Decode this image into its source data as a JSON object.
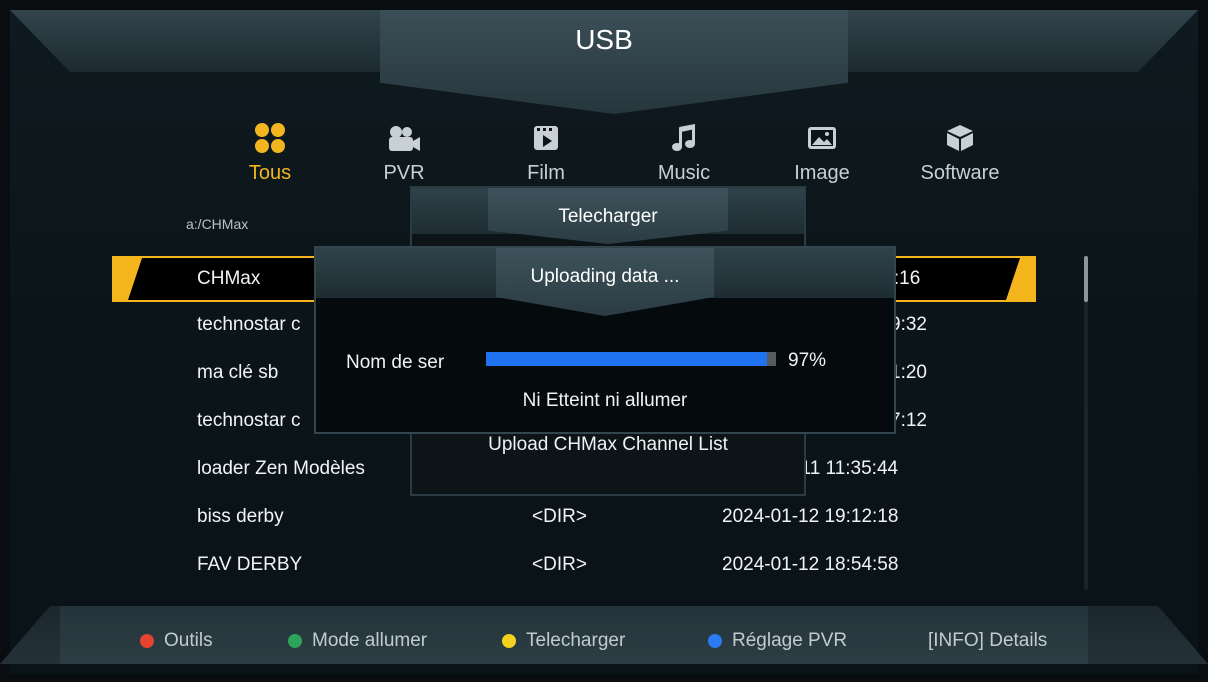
{
  "header": {
    "title": "USB"
  },
  "categories": [
    {
      "label": "Tous",
      "icon": "grid-icon",
      "active": true
    },
    {
      "label": "PVR",
      "icon": "camera-icon",
      "active": false
    },
    {
      "label": "Film",
      "icon": "film-icon",
      "active": false
    },
    {
      "label": "Music",
      "icon": "music-note-icon",
      "active": false
    },
    {
      "label": "Image",
      "icon": "image-icon",
      "active": false
    },
    {
      "label": "Software",
      "icon": "box-icon",
      "active": false
    }
  ],
  "path": "a:/CHMax",
  "files": [
    {
      "name": "CHMax",
      "type": "",
      "date": ":2:16"
    },
    {
      "name": "technostar c",
      "type": "",
      "date": "9:32"
    },
    {
      "name": "ma clé sb",
      "type": "",
      "date": "1:20"
    },
    {
      "name": "technostar c",
      "type": "",
      "date": "7:12"
    },
    {
      "name": "loader Zen Modèles",
      "type": "",
      "date": "l-11 11:35:44"
    },
    {
      "name": "biss derby",
      "type": "<DIR>",
      "date": "2024-01-12 19:12:18"
    },
    {
      "name": "FAV DERBY",
      "type": "<DIR>",
      "date": "2024-01-12 18:54:58"
    }
  ],
  "dialog_download": {
    "title": "Telecharger",
    "message": "Upload CHMax Channel List"
  },
  "dialog_upload": {
    "title": "Uploading data ...",
    "label": "Nom de ser",
    "progress": 97,
    "progress_text": "97%",
    "status": "Ni Etteint ni allumer"
  },
  "footer": [
    {
      "label": "Outils",
      "color": "#e8432e"
    },
    {
      "label": "Mode allumer",
      "color": "#2ea35a"
    },
    {
      "label": "Telecharger",
      "color": "#f2d21e"
    },
    {
      "label": "Réglage PVR",
      "color": "#2a7cf0"
    },
    {
      "label": "[INFO] Details",
      "color": ""
    }
  ],
  "colors": {
    "accent": "#f5b51c",
    "progress": "#1f73f0"
  }
}
